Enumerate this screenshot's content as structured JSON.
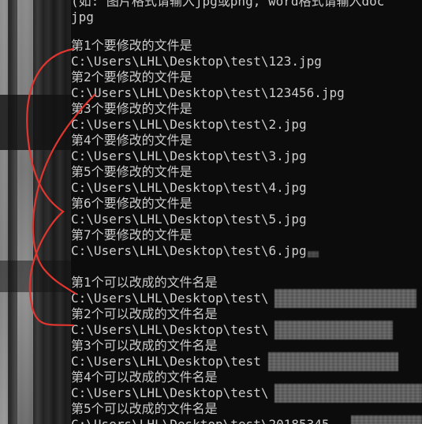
{
  "console": {
    "header_partial": "(如: 图片格式请输入jpg或png, word格式请输入doc",
    "header_cont": "jpg",
    "files_to_modify": [
      {
        "label": "第1个要修改的文件是",
        "path": "C:\\Users\\LHL\\Desktop\\test\\123.jpg"
      },
      {
        "label": "第2个要修改的文件是",
        "path": "C:\\Users\\LHL\\Desktop\\test\\123456.jpg"
      },
      {
        "label": "第3个要修改的文件是",
        "path": "C:\\Users\\LHL\\Desktop\\test\\2.jpg"
      },
      {
        "label": "第4个要修改的文件是",
        "path": "C:\\Users\\LHL\\Desktop\\test\\3.jpg"
      },
      {
        "label": "第5个要修改的文件是",
        "path": "C:\\Users\\LHL\\Desktop\\test\\4.jpg"
      },
      {
        "label": "第6个要修改的文件是",
        "path": "C:\\Users\\LHL\\Desktop\\test\\5.jpg"
      },
      {
        "label": "第7个要修改的文件是",
        "path": "C:\\Users\\LHL\\Desktop\\test\\6.jpg"
      }
    ],
    "new_names": [
      {
        "label": "第1个可以改成的文件名是",
        "path": "C:\\Users\\LHL\\Desktop\\test\\"
      },
      {
        "label": "第2个可以改成的文件名是",
        "path": "C:\\Users\\LHL\\Desktop\\test\\"
      },
      {
        "label": "第3个可以改成的文件名是",
        "path": "C:\\Users\\LHL\\Desktop\\test"
      },
      {
        "label": "第4个可以改成的文件名是",
        "path": "C:\\Users\\LHL\\Desktop\\test\\"
      },
      {
        "label": "第5个可以改成的文件名是",
        "path": "C:\\Users\\LHL\\Desktop\\test\\20185345"
      }
    ]
  },
  "colors": {
    "console_bg": "#0c0c0c",
    "console_text": "#cccccc",
    "annotation": "#e0362f"
  }
}
